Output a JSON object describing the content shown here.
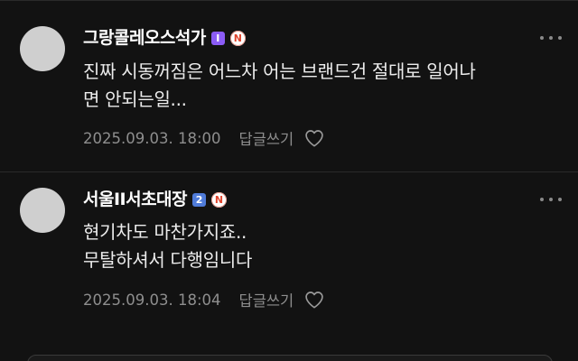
{
  "comments": [
    {
      "author": "그랑콜레오스석가",
      "level_badge": "I",
      "level_color": "#8b5cf6",
      "badge_n": "N",
      "body_lines": [
        "진짜 시동꺼짐은 어느차 어는 브랜드건 절대로 일어나",
        "면 안되는일..."
      ],
      "timestamp": "2025.09.03. 18:00",
      "reply_label": "답글쓰기",
      "more_icon": "more-dots-icon",
      "like_icon": "heart-icon"
    },
    {
      "author": "서울II서초대장",
      "level_badge": "2",
      "level_color": "#4f7bd9",
      "badge_n": "N",
      "body_lines": [
        "현기차도 마찬가지죠..",
        "무탈하셔서 다행임니다"
      ],
      "timestamp": "2025.09.03. 18:04",
      "reply_label": "답글쓰기",
      "more_icon": "more-dots-icon",
      "like_icon": "heart-icon"
    }
  ],
  "colors": {
    "background": "#121212",
    "text": "#ececec",
    "meta": "#8e8e8e",
    "n_badge": "#e0442d"
  }
}
